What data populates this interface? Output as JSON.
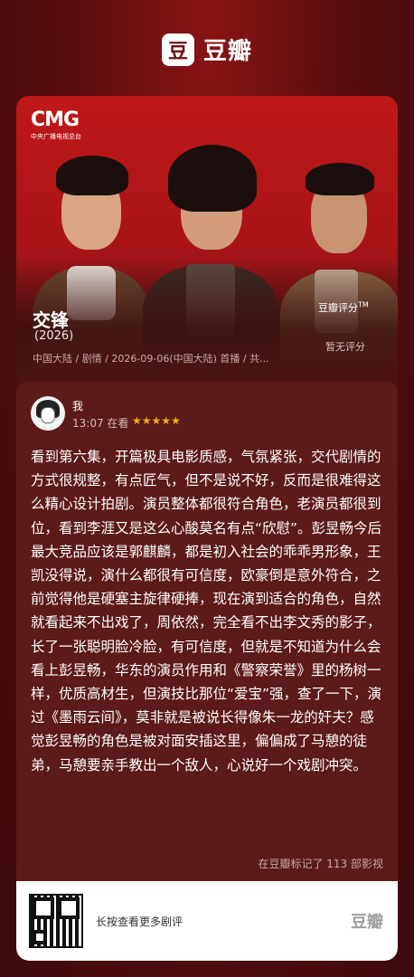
{
  "brand": {
    "icon_char": "豆",
    "name": "豆瓣"
  },
  "poster": {
    "channel_logo": "CMG",
    "channel_sub": "中央广播电视总台"
  },
  "movie": {
    "title": "交锋",
    "year": "(2026)",
    "meta": "中国大陆 / 剧情 / 2026-09-06(中国大陆) 首播 / 共...",
    "rating_label": "豆瓣评分",
    "rating_tm": "TM",
    "rating_value": "暂无评分"
  },
  "review": {
    "username": "我",
    "time_status": "13:07 在看",
    "stars": "★★★★★",
    "rating_stars": 5,
    "body": "看到第六集，开篇极具电影质感，气氛紧张，交代剧情的方式很规整，有点匠气，但不是说不好，反而是很难得这么精心设计拍剧。演员整体都很符合角色，老演员都很到位，看到李涯又是这么心酸莫名有点“欣慰”。彭昱畅今后最大竞品应该是郭麒麟，都是初入社会的乖乖男形象，王凯没得说，演什么都很有可信度，欧豪倒是意外符合，之前觉得他是硬塞主旋律硬捧，现在演到适合的角色，自然就看起来不出戏了，周依然，完全看不出李文秀的影子，长了一张聪明脸冷脸，有可信度，但就是不知道为什么会看上彭昱畅，华东的演员作用和《警察荣誉》里的杨树一样，优质高材生，但演技比那位“爱宝”强，查了一下，演过《墨雨云间》，莫非就是被说长得像朱一龙的奸夫？感觉彭昱畅的角色是被对面安插这里，偏偏成了马憩的徒弟，马憩要亲手教出一个敌人，心说好一个戏剧冲突。",
    "count_text": "在豆瓣标记了 113 部影视"
  },
  "footer": {
    "cta": "长按查看更多剧评",
    "logo": "豆瓣"
  },
  "colors": {
    "background": "#5a0d0f",
    "card": "#5c1a1a",
    "star": "#f5b10a"
  }
}
